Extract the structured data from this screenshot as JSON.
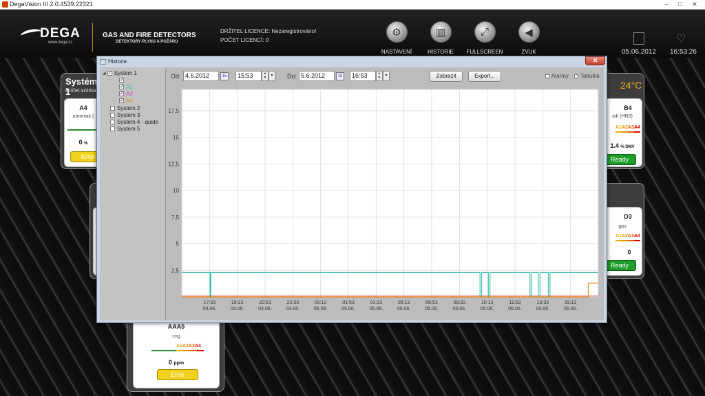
{
  "window": {
    "title": "DegaVision III 2.0.4539.22321",
    "controls": [
      "–",
      "□",
      "✕"
    ]
  },
  "header": {
    "brand": "DEGA",
    "brand_url": "www.dega.cz",
    "product_line1": "GAS AND FIRE DETECTORS",
    "product_line2": "DETEKTORY PLYNU A POŽÁRU",
    "license_holder": "DRŽITEL LICENCE: Nezaregistrováno!",
    "license_count": "POČET LICENCÍ: 0",
    "nav": [
      {
        "label": "NASTAVENÍ",
        "icon": "gear-icon",
        "glyph": "⚙"
      },
      {
        "label": "HISTORIE",
        "icon": "bar-chart-icon",
        "glyph": "▥"
      },
      {
        "label": "FULLSCREEN",
        "icon": "fullscreen-icon",
        "glyph": "⤢"
      },
      {
        "label": "ZVUK",
        "icon": "speaker-icon",
        "glyph": "◀"
      }
    ],
    "date": "05.06.2012",
    "time": "16:53:26"
  },
  "background": {
    "system1_title": "Systém 1",
    "system1_sub": "Počet snímač",
    "temperature": "24°C",
    "tiles": [
      {
        "name": "A4",
        "gas": "amoniak (",
        "value": "0",
        "unit": "%",
        "status": "Error"
      },
      {
        "name": "B4",
        "gas": "iak (HN3)",
        "value": "1.4",
        "unit": "% DMV",
        "status": "Ready"
      },
      {
        "name": "D3",
        "gas": "gas",
        "value": "0",
        "unit": "",
        "status": "Ready"
      },
      {
        "name": "AAA5",
        "gas": "cng",
        "value": "0",
        "unit": "ppm",
        "status": "Error"
      }
    ],
    "alarm_labels": [
      "A1",
      "A2",
      "A3",
      "A4"
    ],
    "colors": {
      "error": "#f2d21b",
      "ready": "#1f9d2a"
    }
  },
  "dialog": {
    "title": "Historie",
    "close": "✕",
    "tree": [
      {
        "label": "Systém 1",
        "checked": true,
        "expanded": true,
        "children": [
          {
            "label": "A1",
            "checked": true,
            "color": "#e8b0b0"
          },
          {
            "label": "A2",
            "checked": true,
            "color": "#40c0b0"
          },
          {
            "label": "A3",
            "checked": true,
            "color": "#c040c0"
          },
          {
            "label": "A4",
            "checked": true,
            "color": "#e08a20"
          }
        ]
      },
      {
        "label": "Systém 2",
        "checked": false
      },
      {
        "label": "Systém 3",
        "checked": false
      },
      {
        "label": "Systém 4 - quido",
        "checked": false
      },
      {
        "label": "Systém 5",
        "checked": false
      }
    ],
    "from_label": "Od:",
    "from_date": "4.6.2012",
    "from_time": "15:53",
    "to_label": "Do:",
    "to_date": "5.6.2012",
    "to_time": "16:53",
    "show_button": "Zobrazit",
    "export_button": "Export...",
    "opt_alarms": "Alarmy",
    "opt_table": "Tabulka",
    "calendar_glyph": "15"
  },
  "chart_data": {
    "type": "line",
    "ylim": [
      0,
      19.5
    ],
    "yticks": [
      "2,5",
      "5",
      "7,5",
      "10",
      "12,5",
      "15",
      "17,5"
    ],
    "ytick_values": [
      2.5,
      5,
      7.5,
      10,
      12.5,
      15,
      17.5
    ],
    "xticks": [
      [
        "17:33",
        "04.06."
      ],
      [
        "19:13",
        "04.06."
      ],
      [
        "20:53",
        "04.06."
      ],
      [
        "22:33",
        "04.06."
      ],
      [
        "00:13",
        "05.06."
      ],
      [
        "01:53",
        "05.06."
      ],
      [
        "03:33",
        "05.06."
      ],
      [
        "05:13",
        "05.06."
      ],
      [
        "06:53",
        "05.06."
      ],
      [
        "08:33",
        "05.06."
      ],
      [
        "10:13",
        "05.06."
      ],
      [
        "11:53",
        "05.06."
      ],
      [
        "13:33",
        "05.06."
      ],
      [
        "15:13",
        "05.06."
      ]
    ],
    "xtick_hours": [
      1.67,
      3.33,
      5.0,
      6.67,
      8.33,
      10.0,
      11.67,
      13.33,
      15.0,
      16.67,
      18.33,
      20.0,
      21.67,
      23.33
    ],
    "xlim_hours": [
      0,
      25
    ],
    "grid": true,
    "series": [
      {
        "color": "#40c0b0",
        "points": [
          [
            0,
            2.3
          ],
          [
            1.7,
            2.3
          ],
          [
            1.7,
            0
          ],
          [
            1.75,
            0
          ],
          [
            1.75,
            2.3
          ],
          [
            17.9,
            2.3
          ],
          [
            17.9,
            0
          ],
          [
            18.0,
            0
          ],
          [
            18.0,
            2.3
          ],
          [
            18.4,
            2.3
          ],
          [
            18.4,
            0
          ],
          [
            18.5,
            0
          ],
          [
            18.5,
            2.3
          ],
          [
            20.9,
            2.3
          ],
          [
            20.9,
            0
          ],
          [
            21.0,
            0
          ],
          [
            21.0,
            2.3
          ],
          [
            21.4,
            2.3
          ],
          [
            21.4,
            0
          ],
          [
            21.5,
            0
          ],
          [
            21.5,
            2.3
          ],
          [
            22.0,
            2.3
          ],
          [
            22.0,
            0
          ],
          [
            22.1,
            0
          ],
          [
            22.1,
            2.3
          ],
          [
            25,
            2.3
          ]
        ]
      },
      {
        "color": "#e06060",
        "points": [
          [
            0,
            0.1
          ],
          [
            25,
            0.1
          ]
        ]
      },
      {
        "color": "#e08a20",
        "points": [
          [
            0,
            0
          ],
          [
            24.4,
            0
          ],
          [
            24.4,
            1.3
          ],
          [
            25,
            1.3
          ]
        ]
      }
    ]
  }
}
